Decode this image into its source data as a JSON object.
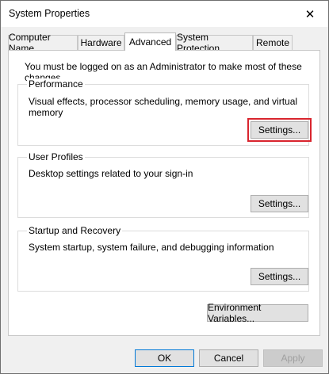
{
  "window": {
    "title": "System Properties",
    "close_label": "✕"
  },
  "tabs": [
    {
      "label": "Computer Name"
    },
    {
      "label": "Hardware"
    },
    {
      "label": "Advanced"
    },
    {
      "label": "System Protection"
    },
    {
      "label": "Remote"
    }
  ],
  "active_tab": "Advanced",
  "advanced": {
    "intro": "You must be logged on as an Administrator to make most of these changes.",
    "performance": {
      "label": "Performance",
      "description": "Visual effects, processor scheduling, memory usage, and virtual memory",
      "button": "Settings..."
    },
    "user_profiles": {
      "label": "User Profiles",
      "description": "Desktop settings related to your sign-in",
      "button": "Settings..."
    },
    "startup_recovery": {
      "label": "Startup and Recovery",
      "description": "System startup, system failure, and debugging information",
      "button": "Settings..."
    },
    "env_button": "Environment Variables..."
  },
  "footer": {
    "ok": "OK",
    "cancel": "Cancel",
    "apply": "Apply"
  },
  "colors": {
    "highlight": "#d9252e",
    "button_face": "#e1e1e1",
    "dialog_bg": "#f0f0f0"
  }
}
